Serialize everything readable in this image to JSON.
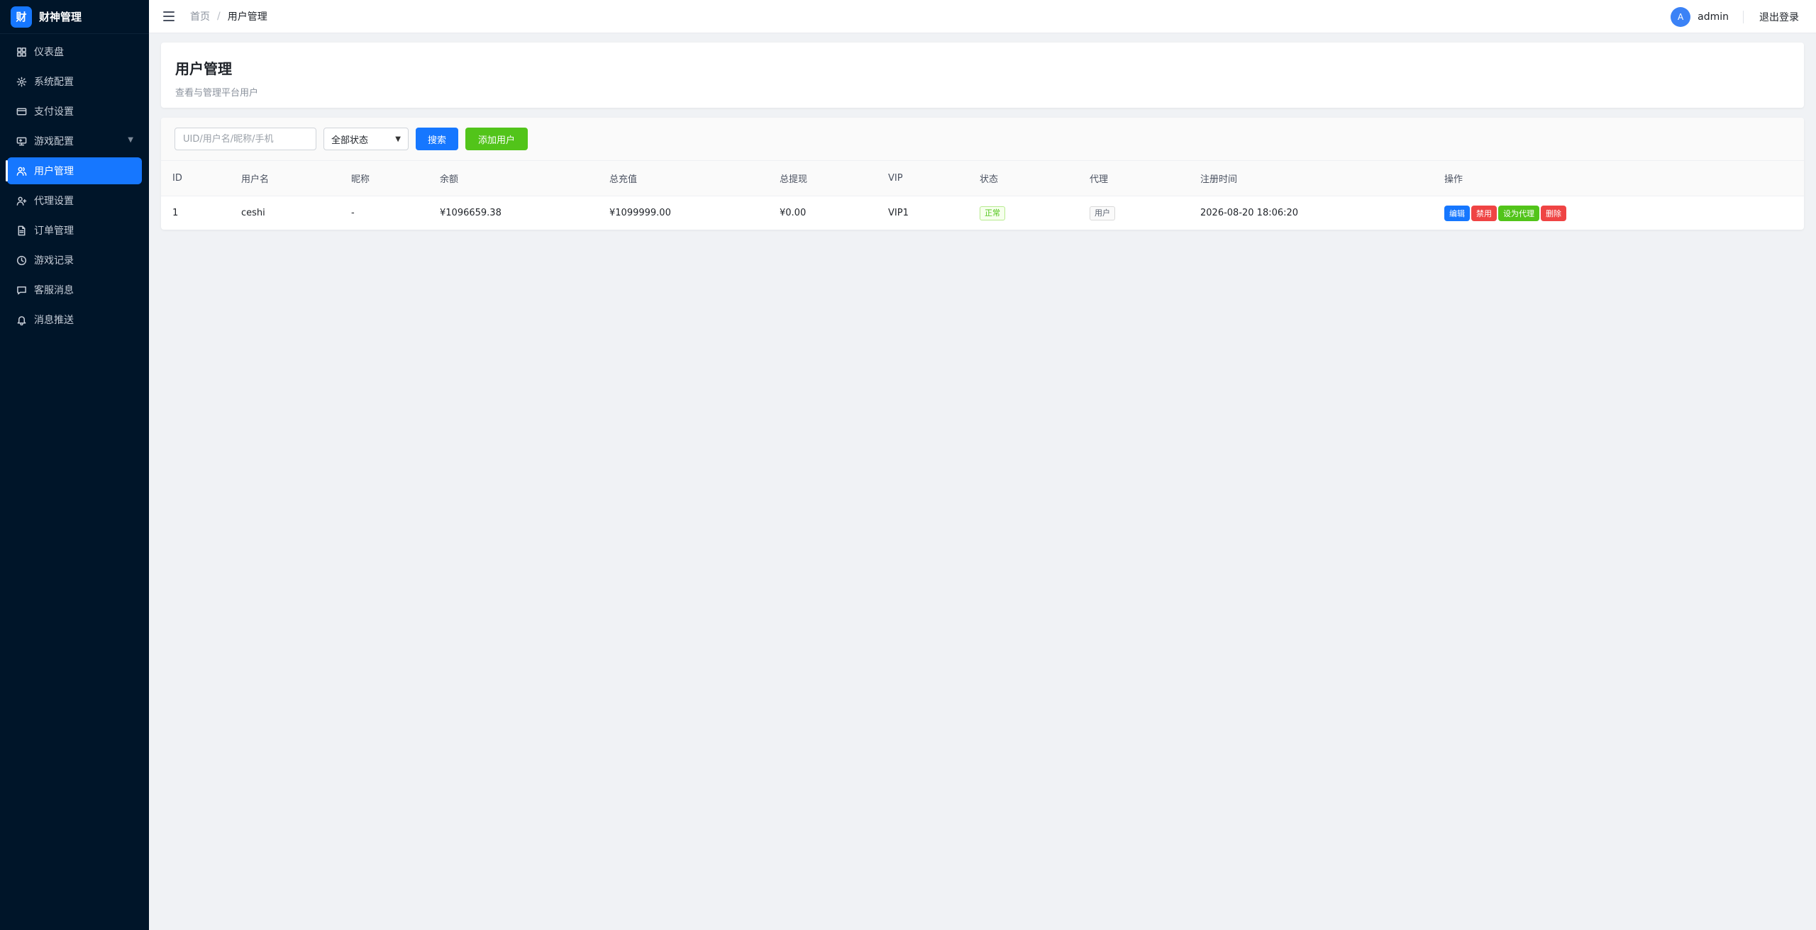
{
  "brand": {
    "logo_char": "财",
    "name": "财神管理"
  },
  "sidebar": {
    "items": [
      {
        "label": "仪表盘",
        "icon": "dashboard-icon"
      },
      {
        "label": "系统配置",
        "icon": "gear-icon"
      },
      {
        "label": "支付设置",
        "icon": "credit-card-icon"
      },
      {
        "label": "游戏配置",
        "icon": "gamepad-icon",
        "caret": "▼"
      },
      {
        "label": "用户管理",
        "icon": "users-icon",
        "active": true
      },
      {
        "label": "代理设置",
        "icon": "user-plus-icon"
      },
      {
        "label": "订单管理",
        "icon": "document-icon"
      },
      {
        "label": "游戏记录",
        "icon": "clock-icon"
      },
      {
        "label": "客服消息",
        "icon": "chat-icon"
      },
      {
        "label": "消息推送",
        "icon": "bell-icon"
      }
    ]
  },
  "header": {
    "breadcrumb": {
      "home": "首页",
      "separator": "/",
      "current": "用户管理"
    },
    "user": {
      "avatar_letter": "A",
      "name": "admin"
    },
    "logout_label": "退出登录"
  },
  "page": {
    "title": "用户管理",
    "subtitle": "查看与管理平台用户"
  },
  "toolbar": {
    "search_placeholder": "UID/用户名/昵称/手机",
    "status_selected": "全部状态",
    "search_label": "搜索",
    "add_label": "添加用户"
  },
  "table": {
    "columns": [
      "ID",
      "用户名",
      "昵称",
      "余额",
      "总充值",
      "总提现",
      "VIP",
      "状态",
      "代理",
      "注册时间",
      "操作"
    ],
    "rows": [
      {
        "id": "1",
        "username": "ceshi",
        "nickname": "-",
        "balance": "¥1096659.38",
        "total_recharge": "¥1099999.00",
        "total_withdraw": "¥0.00",
        "vip": "VIP1",
        "status": "正常",
        "agent": "用户",
        "registered": "2026-08-20 18:06:20",
        "actions": {
          "edit": "编辑",
          "disable": "禁用",
          "set_agent": "设为代理",
          "delete": "删除"
        }
      }
    ]
  },
  "colors": {
    "sidebar_bg": "#001529",
    "primary": "#1677ff",
    "success": "#52c41a",
    "danger": "#ef4444"
  }
}
